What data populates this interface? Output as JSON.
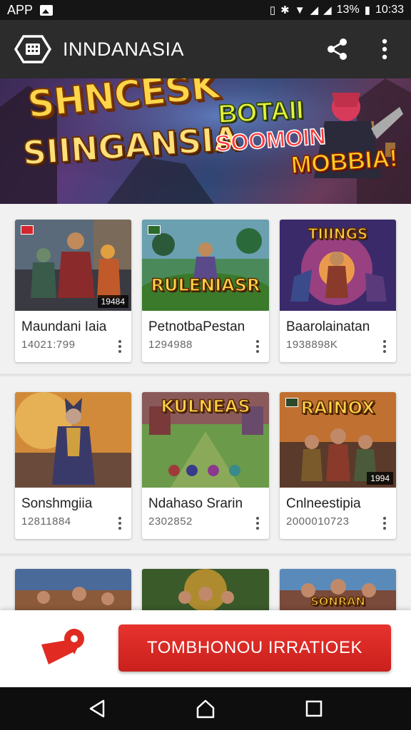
{
  "status_bar": {
    "left_label": "APP",
    "battery": "13%",
    "time": "10:33"
  },
  "app_bar": {
    "title": "INNDANASIA",
    "icons": [
      "app-logo-icon",
      "share-icon",
      "more-vert-icon"
    ]
  },
  "banner": {
    "title_line_1": "SHNCESK",
    "title_line_2": "SIINGANSIA",
    "sub_line_1": "BOTAII",
    "sub_line_2": "SOOMOIN",
    "sub_line_3": "MOBBIA!"
  },
  "games": [
    {
      "title": "Maundani Iaia",
      "meta": "14021:799",
      "thumb_tag": "19484"
    },
    {
      "title": "PetnotbaPestan",
      "meta": "1294988",
      "thumb_logo": "RULENIASR"
    },
    {
      "title": "Baarolainatan",
      "meta": "1938898K",
      "thumb_logo": "TIIINGS"
    },
    {
      "title": "Sonshmgiia",
      "meta": "12811884"
    },
    {
      "title": "Ndahaso Srarin",
      "meta": "2302852",
      "thumb_logo": "KULNEAS"
    },
    {
      "title": "Cnlneestipia",
      "meta": "2000010723",
      "thumb_logo": "RAINOX",
      "thumb_tag": "1994"
    }
  ],
  "partial_row": {
    "thumb_logo_3": "SONRAN"
  },
  "action_bar": {
    "cta_label": "TOMBHONOU IRRATIOEK",
    "pin_icon": "location-pin-icon"
  },
  "nav_bar": {
    "icons": [
      "back-icon",
      "home-icon",
      "recents-icon"
    ]
  },
  "colors": {
    "app_bar_bg": "#2c2c2c",
    "cta_red": "#d9261f",
    "page_bg": "#f1f1f1"
  }
}
